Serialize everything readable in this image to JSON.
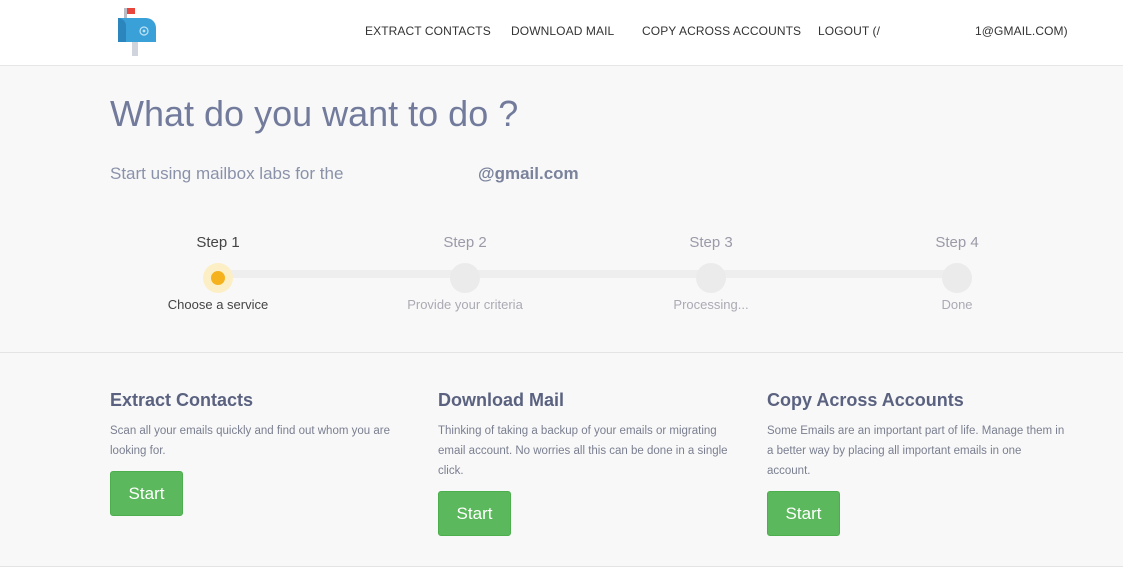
{
  "nav": {
    "extract": "EXTRACT CONTACTS",
    "download": "DOWNLOAD MAIL",
    "copy": "COPY ACROSS ACCOUNTS",
    "logout": "LOGOUT (/",
    "account_tail": "1@GMAIL.COM)"
  },
  "hero": {
    "title": "What do you want to do ?",
    "subtitle": "Start using mailbox labs for the",
    "email": "@gmail.com"
  },
  "steps": [
    {
      "label": "Step 1",
      "desc": "Choose a service",
      "active": true
    },
    {
      "label": "Step 2",
      "desc": "Provide your criteria",
      "active": false
    },
    {
      "label": "Step 3",
      "desc": "Processing...",
      "active": false
    },
    {
      "label": "Step 4",
      "desc": "Done",
      "active": false
    }
  ],
  "services": [
    {
      "title": "Extract Contacts",
      "desc": "Scan all your emails quickly and find out whom you are looking for.",
      "button": "Start"
    },
    {
      "title": "Download Mail",
      "desc": "Thinking of taking a backup of your emails or migrating email account. No worries all this can be done in a single click.",
      "button": "Start"
    },
    {
      "title": "Copy Across Accounts",
      "desc": "Some Emails are an important part of life. Manage them in a better way by placing all important emails in one account.",
      "button": "Start"
    }
  ],
  "colors": {
    "accent_green": "#5cb85c",
    "step_active": "#f5b21c",
    "logo_blue": "#3aa0d8",
    "logo_flag": "#e8453c"
  },
  "icons": {
    "logo": "mailbox-icon"
  }
}
